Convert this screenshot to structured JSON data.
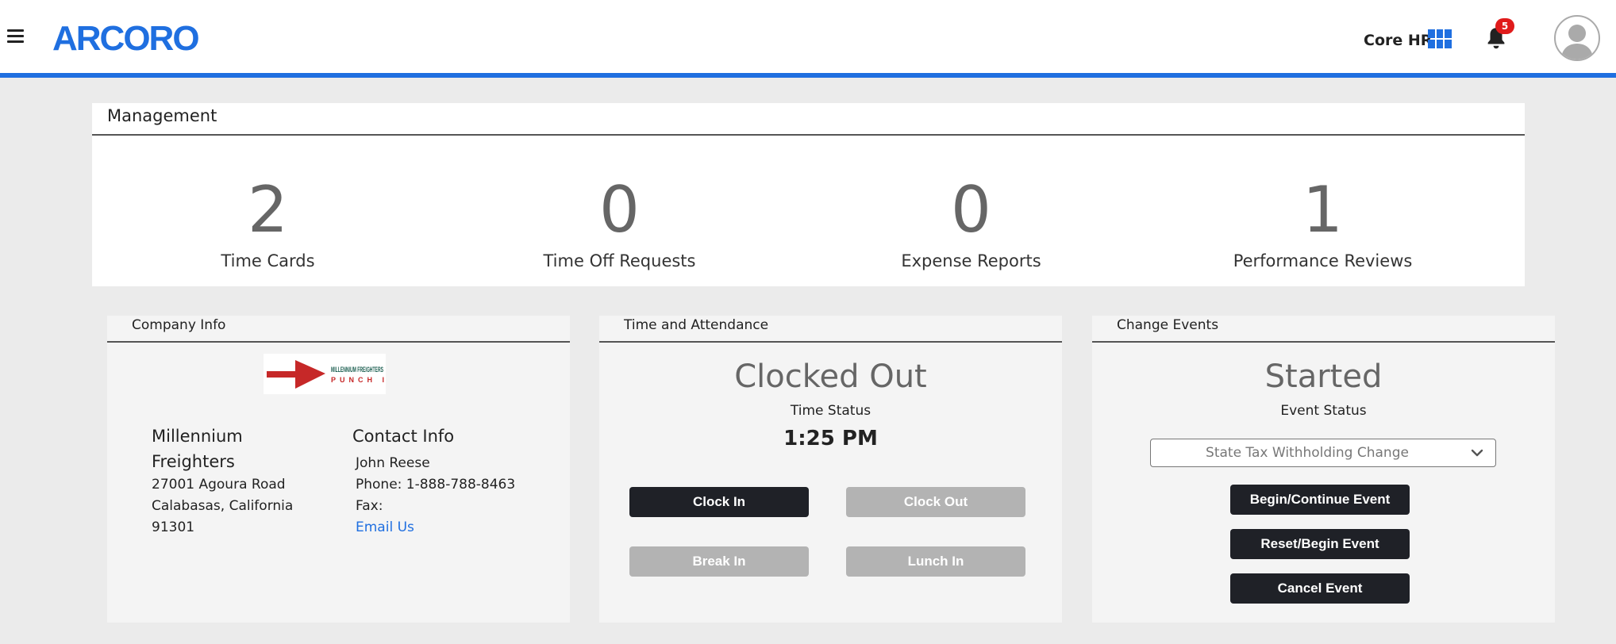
{
  "header": {
    "logo": "ARCORO",
    "module_label": "Core HR",
    "notification_count": "5",
    "accent_color": "#1f6fe0"
  },
  "management": {
    "title": "Management",
    "stats": [
      {
        "value": "2",
        "label": "Time Cards"
      },
      {
        "value": "0",
        "label": "Time Off Requests"
      },
      {
        "value": "0",
        "label": "Expense Reports"
      },
      {
        "value": "1",
        "label": "Performance Reviews"
      }
    ]
  },
  "company_info": {
    "title": "Company Info",
    "logo_text_top": "MILLENNIUM FREIGHTERS",
    "logo_text_bottom": "PUNCH IT",
    "name": "Millennium Freighters",
    "address_line1": "27001 Agoura Road",
    "address_line2": "Calabasas, California",
    "address_line3": "91301",
    "contact_title": "Contact Info",
    "contact_name": "John Reese",
    "phone": "Phone: 1-888-788-8463",
    "fax": "Fax:",
    "email_link": "Email Us"
  },
  "time_attendance": {
    "title": "Time and Attendance",
    "status": "Clocked Out",
    "status_label": "Time Status",
    "time": "1:25 PM",
    "buttons": {
      "clock_in": "Clock In",
      "clock_out": "Clock Out",
      "break_in": "Break In",
      "lunch_in": "Lunch In"
    }
  },
  "change_events": {
    "title": "Change Events",
    "status": "Started",
    "status_label": "Event Status",
    "selected_event": "State Tax Withholding Change",
    "buttons": {
      "begin_continue": "Begin/Continue Event",
      "reset_begin": "Reset/Begin Event",
      "cancel": "Cancel Event"
    }
  }
}
